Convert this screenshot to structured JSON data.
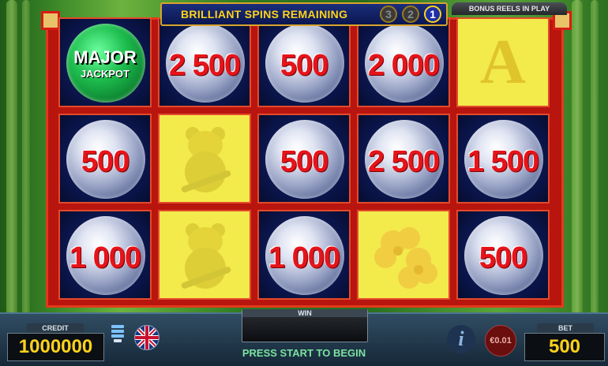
{
  "header": {
    "title": "BRILLIANT SPINS REMAINING",
    "counters": [
      "3",
      "2",
      "1"
    ],
    "active_counter": "1"
  },
  "bonus_label": "BONUS REELS IN PLAY",
  "grid": {
    "rows": [
      [
        {
          "type": "jackpot",
          "line1": "MAJOR",
          "line2": "JACKPOT"
        },
        {
          "type": "gem",
          "value": "2 500"
        },
        {
          "type": "gem",
          "value": "500"
        },
        {
          "type": "gem",
          "value": "2 000"
        },
        {
          "type": "ace-symbol",
          "label": "A"
        }
      ],
      [
        {
          "type": "gem",
          "value": "500"
        },
        {
          "type": "panda-symbol"
        },
        {
          "type": "gem",
          "value": "500"
        },
        {
          "type": "gem",
          "value": "2 500"
        },
        {
          "type": "gem",
          "value": "1 500"
        }
      ],
      [
        {
          "type": "gem",
          "value": "1 000"
        },
        {
          "type": "panda-symbol"
        },
        {
          "type": "gem",
          "value": "1 000"
        },
        {
          "type": "flower-symbol"
        },
        {
          "type": "gem",
          "value": "500"
        }
      ]
    ]
  },
  "console": {
    "credit_label": "CREDIT",
    "credit_value": "1000000",
    "win_label": "WIN",
    "bet_label": "BET",
    "bet_value": "500",
    "prompt": "PRESS START TO BEGIN",
    "denomination": "€0.01",
    "info_label": "i"
  },
  "colors": {
    "value_red": "#e6141a",
    "header_yellow": "#ffd21a",
    "frame_red": "#b8150f",
    "held_yellow": "#f3ea4c"
  }
}
